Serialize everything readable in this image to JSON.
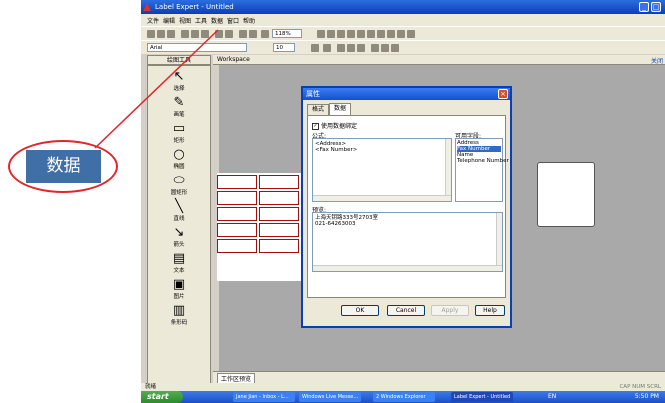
{
  "callout": {
    "text": "数据"
  },
  "app": {
    "title": "Label Expert - Untitled",
    "menu": [
      "文件",
      "编辑",
      "视图",
      "工具",
      "数据",
      "窗口",
      "帮助"
    ],
    "zoom": "118%",
    "font_name": "Arial",
    "font_size": "10",
    "panel_tab": "绘图工具",
    "tools": [
      {
        "label": "选择",
        "icon": "pointer-icon"
      },
      {
        "label": "画笔",
        "icon": "pen-icon"
      },
      {
        "label": "矩形",
        "icon": "rectangle-icon"
      },
      {
        "label": "椭圆",
        "icon": "ellipse-icon"
      },
      {
        "label": "圆矩形",
        "icon": "rounded-rect-icon"
      },
      {
        "label": "直线",
        "icon": "line-icon"
      },
      {
        "label": "箭头",
        "icon": "arrow-icon"
      },
      {
        "label": "文本",
        "icon": "text-icon"
      },
      {
        "label": "图片",
        "icon": "image-icon"
      },
      {
        "label": "条形码",
        "icon": "barcode-icon"
      }
    ],
    "workspace_title": "Workspace",
    "workspace_tab": "工作区预览",
    "status_left": "就绪",
    "status_right": "CAP NUM SCRL",
    "right_edge_text": "关闭"
  },
  "dialog": {
    "title": "属性",
    "tabs": [
      "格式",
      "数据"
    ],
    "active_tab": "数据",
    "use_binding_label": "使用数据绑定",
    "formula_label": "公式:",
    "formula_lines": [
      "<Address>",
      "<Fax Number>"
    ],
    "fields_label": "可用字段:",
    "fields": [
      "Address",
      "Fax Number",
      "Name",
      "Telephone Number"
    ],
    "selected_field": "Fax Number",
    "preview_label": "预览:",
    "preview_lines": [
      "上海天钥路333号2703室",
      "021-64263003"
    ],
    "buttons": {
      "ok": "OK",
      "cancel": "Cancel",
      "apply": "Apply",
      "help": "Help"
    }
  },
  "taskbar": {
    "start": "start",
    "tasks": [
      "Jane Jian - Inbox - L...",
      "Windows Live Messe...",
      "2 Windows Explorer",
      "Label Expert - Untitled"
    ],
    "lang": "EN",
    "clock": "5:50 PM"
  },
  "colors": {
    "callout_ring": "#e1262c",
    "callout_box": "#3f6fa6",
    "titlebar": "#1150cf"
  }
}
